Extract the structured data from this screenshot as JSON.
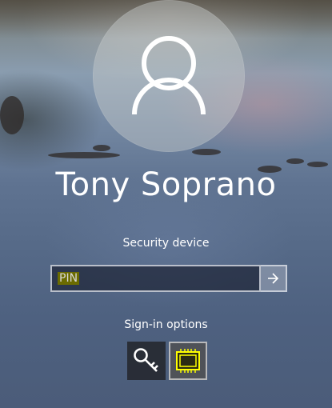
{
  "user": {
    "name": "Tony Soprano",
    "avatar_icon": "user-silhouette-icon"
  },
  "signin": {
    "method_label": "Security device",
    "pin_placeholder": "PIN",
    "submit_icon": "arrow-right-icon",
    "options_label": "Sign-in options",
    "options": [
      {
        "icon": "key-icon",
        "selected": false
      },
      {
        "icon": "chip-icon",
        "selected": true
      }
    ]
  },
  "colors": {
    "text": "#ffffff",
    "highlight": "#ffff00",
    "input_bg": "#1e2637"
  }
}
